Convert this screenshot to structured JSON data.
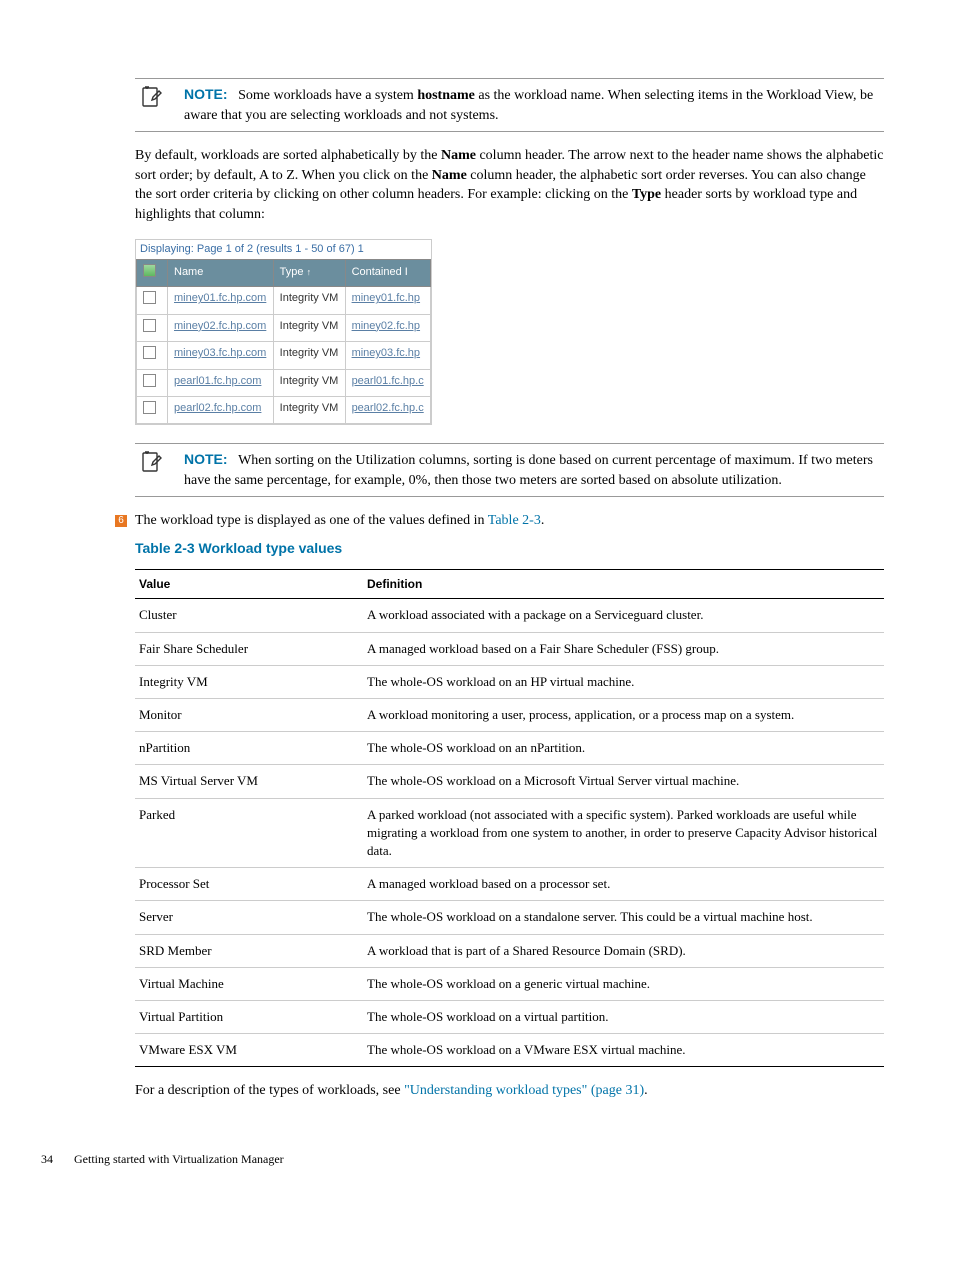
{
  "note1": {
    "label": "NOTE:",
    "body_before": "Some workloads have a system ",
    "body_bold": "hostname",
    "body_after": " as the workload name. When selecting items in the Workload View, be aware that you are selecting workloads and not systems."
  },
  "para1": {
    "seg1": "By default, workloads are sorted alphabetically by the ",
    "bold1": "Name",
    "seg2": " column header. The arrow next to the header name shows the alphabetic sort order; by default, A to Z. When you click on the ",
    "bold2": "Name",
    "seg3": " column header, the alphabetic sort order reverses. You can also change the sort order criteria by clicking on other column headers. For example: clicking on the ",
    "bold3": "Type",
    "seg4": " header sorts by workload type and highlights that column:"
  },
  "screenshot": {
    "display_text": "Displaying: Page 1 of 2 (results 1 - 50 of 67) 1",
    "headers": {
      "name": "Name",
      "type": "Type",
      "contained": "Contained I",
      "arrow": "↑"
    },
    "rows": [
      {
        "name": "miney01.fc.hp.com",
        "type": "Integrity VM",
        "contained": "miney01.fc.hp"
      },
      {
        "name": "miney02.fc.hp.com",
        "type": "Integrity VM",
        "contained": "miney02.fc.hp"
      },
      {
        "name": "miney03.fc.hp.com",
        "type": "Integrity VM",
        "contained": "miney03.fc.hp"
      },
      {
        "name": "pearl01.fc.hp.com",
        "type": "Integrity VM",
        "contained": "pearl01.fc.hp.c"
      },
      {
        "name": "pearl02.fc.hp.com",
        "type": "Integrity VM",
        "contained": "pearl02.fc.hp.c"
      }
    ]
  },
  "note2": {
    "label": "NOTE:",
    "body": "When sorting on the Utilization columns, sorting is done based on current percentage of maximum. If two meters have the same percentage, for example, 0%, then those two meters are sorted based on absolute utilization."
  },
  "callout6": {
    "num": "6",
    "seg1": "The workload type is displayed as one of the values defined in ",
    "link": "Table 2-3",
    "seg2": "."
  },
  "table_title": "Table 2-3 Workload type values",
  "table_headers": {
    "value": "Value",
    "definition": "Definition"
  },
  "table_rows": [
    {
      "value": "Cluster",
      "def": "A workload associated with a package on a Serviceguard cluster."
    },
    {
      "value": "Fair Share Scheduler",
      "def": "A managed workload based on a Fair Share Scheduler (FSS) group."
    },
    {
      "value": "Integrity VM",
      "def": "The whole-OS workload on an HP virtual machine."
    },
    {
      "value": "Monitor",
      "def": "A workload monitoring a user, process, application, or a process map on a system."
    },
    {
      "value": "nPartition",
      "def": "The whole-OS workload on an nPartition."
    },
    {
      "value": "MS Virtual Server VM",
      "def": "The whole-OS workload on a Microsoft Virtual Server virtual machine."
    },
    {
      "value": "Parked",
      "def": "A parked workload (not associated with a specific system). Parked workloads are useful while migrating a workload from one system to another, in order to preserve Capacity Advisor historical data."
    },
    {
      "value": "Processor Set",
      "def": "A managed workload based on a processor set."
    },
    {
      "value": "Server",
      "def": "The whole-OS workload on a standalone server. This could be a virtual machine host."
    },
    {
      "value": "SRD Member",
      "def": "A workload that is part of a Shared Resource Domain (SRD)."
    },
    {
      "value": "Virtual Machine",
      "def": "The whole-OS workload on a generic virtual machine."
    },
    {
      "value": "Virtual Partition",
      "def": "The whole-OS workload on a virtual partition."
    },
    {
      "value": "VMware ESX VM",
      "def": "The whole-OS workload on a VMware ESX virtual machine."
    }
  ],
  "closing": {
    "seg1": "For a description of the types of workloads, see ",
    "link": "\"Understanding workload types\" (page 31)",
    "seg2": "."
  },
  "footer": {
    "page": "34",
    "title": "Getting started with Virtualization Manager"
  }
}
